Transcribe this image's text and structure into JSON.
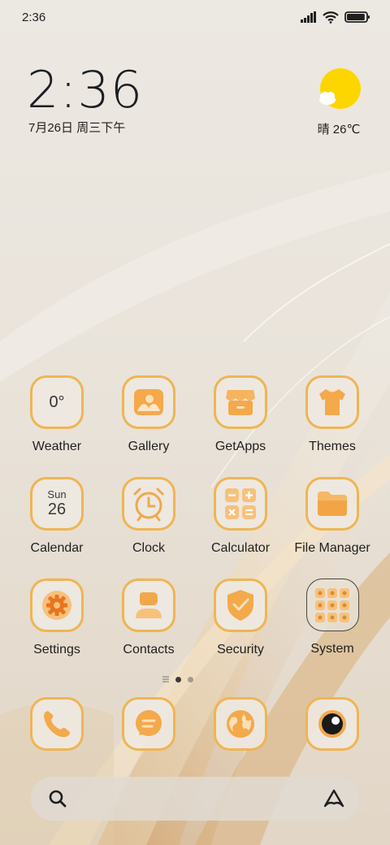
{
  "status_bar": {
    "time": "2:36",
    "battery_level": 0.95
  },
  "clock_widget": {
    "time": "2:36",
    "date": "7月26日 周三下午"
  },
  "weather_widget": {
    "text": "晴 26℃",
    "icon": "sun-cloud-icon"
  },
  "apps": [
    {
      "label": "Weather",
      "icon_text": "0°",
      "icon": "weather-icon"
    },
    {
      "label": "Gallery",
      "icon": "gallery-icon"
    },
    {
      "label": "GetApps",
      "icon": "store-icon"
    },
    {
      "label": "Themes",
      "icon": "tshirt-icon"
    },
    {
      "label": "Calendar",
      "icon_day": "Sun",
      "icon_num": "26",
      "icon": "calendar-icon"
    },
    {
      "label": "Clock",
      "icon": "alarm-clock-icon"
    },
    {
      "label": "Calculator",
      "icon": "calculator-icon"
    },
    {
      "label": "File Manager",
      "icon": "folder-icon"
    },
    {
      "label": "Settings",
      "icon": "gear-icon"
    },
    {
      "label": "Contacts",
      "icon": "person-icon"
    },
    {
      "label": "Security",
      "icon": "shield-check-icon"
    },
    {
      "label": "System",
      "icon": "folder-grid-icon"
    }
  ],
  "page_indicator": {
    "pages": 2,
    "current": 1
  },
  "dock": [
    {
      "name": "phone",
      "icon": "phone-icon"
    },
    {
      "name": "messages",
      "icon": "chat-icon"
    },
    {
      "name": "browser",
      "icon": "globe-icon"
    },
    {
      "name": "camera",
      "icon": "camera-lens-icon"
    }
  ],
  "search_bar": {
    "left_icon": "search-icon",
    "right_icon": "assistant-icon"
  },
  "colors": {
    "accent": "#f0a94a",
    "icon_border": "#efb553",
    "sun": "#fdd600"
  }
}
